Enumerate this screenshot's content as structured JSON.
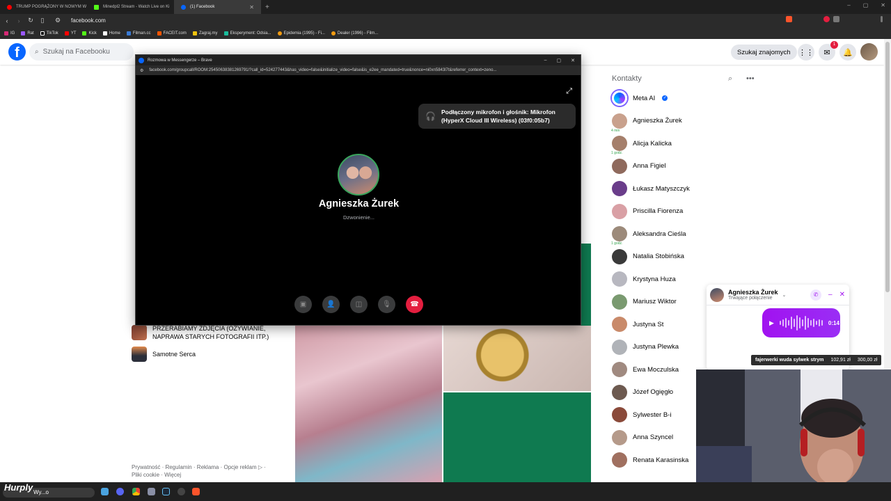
{
  "browser": {
    "tabs": [
      {
        "label": "TRUMP POGRĄŻONY W NOWYM W",
        "icon": "youtube-icon",
        "color": "#ff0000"
      },
      {
        "label": "Minedpl2 Stream - Watch Live on Ki",
        "icon": "kick-icon",
        "color": "#53fc18"
      },
      {
        "label": "(1) Facebook",
        "icon": "facebook-icon",
        "color": "#0866ff"
      }
    ],
    "url": "facebook.com",
    "bookmarks": [
      "IG",
      "Rat",
      "TikTok",
      "YT",
      "Kick",
      "Home",
      "Filman.cc",
      "FACEIT.com",
      "Zagraj.my",
      "Eksperyment: Odsia...",
      "Epidemia (1995) - Fi...",
      "Dealer (1996) - Film..."
    ]
  },
  "facebook": {
    "search_placeholder": "Szukaj na Facebooku",
    "find_friends": "Szukaj znajomych",
    "messenger_badge": "1",
    "left": {
      "item1": "PRZERABIAMY ZDJĘCIA (OŻYWIANIE, NAPRAWA STARYCH FOTOGRAFII ITP.)",
      "item2": "Samotne Serca",
      "footer": "Prywatność · Regulamin · Reklama · Opcje reklam ▷ · Pliki cookie · Więcej"
    },
    "contacts_title": "Kontakty",
    "contacts": [
      {
        "name": "Meta AI",
        "verified": true
      },
      {
        "name": "Agnieszka Żurek",
        "tag": "4 min"
      },
      {
        "name": "Alicja Kalicka",
        "tag": "1 godz."
      },
      {
        "name": "Anna Figiel"
      },
      {
        "name": "Łukasz Matyszczyk"
      },
      {
        "name": "Priscilla Fiorenza"
      },
      {
        "name": "Aleksandra Cieśla",
        "tag": "1 godz."
      },
      {
        "name": "Natalia Stobińska"
      },
      {
        "name": "Krystyna Huza"
      },
      {
        "name": "Mariusz Wiktor"
      },
      {
        "name": "Justyna St"
      },
      {
        "name": "Justyna Plewka"
      },
      {
        "name": "Ewa Moczulska"
      },
      {
        "name": "Józef Ogięgło"
      },
      {
        "name": "Sylwester B-i"
      },
      {
        "name": "Anna Szyncel"
      },
      {
        "name": "Renata Karasinska"
      }
    ]
  },
  "call_window": {
    "title": "Rozmowa w Messengerze – Brave",
    "url": "facebook.com/groupcall/ROOM:25450638381269791/?call_id=524277443&has_video=false&initialize_video=false&is_e2ee_mandated=true&nonce=ni0xn5843l7t&referrer_context=zeno...",
    "toast": "Podłączony mikrofon i głośnik: Mikrofon (HyperX Cloud III Wireless) (03f0:05b7)",
    "callee": "Agnieszka Żurek",
    "status": "Dzwonienie..."
  },
  "mini_chat": {
    "name": "Agnieszka Żurek",
    "status": "Trwające połączenie",
    "voice_duration": "0:14"
  },
  "donation": {
    "text": "fajerwerki wuda sylwek strym",
    "amount1": "102,91 zł",
    "amount2": "300,00 zł"
  },
  "taskbar": {
    "logo": "Hurply",
    "search": "Wy...o"
  }
}
